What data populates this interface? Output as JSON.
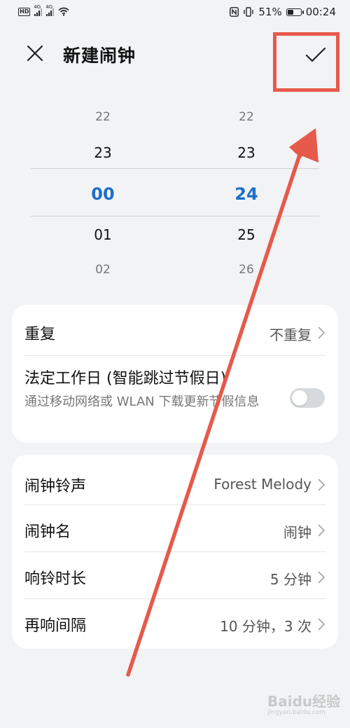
{
  "status_bar": {
    "hd": "HD",
    "net1": "4G",
    "net2": "4G",
    "battery_percent": "51%",
    "battery_level": 0.51,
    "time": "00:24"
  },
  "header": {
    "title": "新建闹钟"
  },
  "picker": {
    "hours": [
      "22",
      "23",
      "00",
      "01",
      "02"
    ],
    "minutes": [
      "22",
      "23",
      "24",
      "25",
      "26"
    ]
  },
  "settings_card_1": {
    "repeat_label": "重复",
    "repeat_value": "不重复",
    "workday_label": "法定工作日 (智能跳过节假日)",
    "workday_sub": "通过移动网络或 WLAN 下载更新节假信息",
    "workday_enabled": false
  },
  "settings_card_2": {
    "rows": [
      {
        "label": "闹钟铃声",
        "value": "Forest Melody"
      },
      {
        "label": "闹钟名",
        "value": "闹钟"
      },
      {
        "label": "响铃时长",
        "value": "5 分钟"
      },
      {
        "label": "再响间隔",
        "value": "10 分钟，3 次"
      }
    ]
  },
  "watermark": {
    "brand": "Baidu经验",
    "url": "jingyan.baidu.com"
  },
  "colors": {
    "accent": "#1e6fc7",
    "annotation": "#e65a4b",
    "background": "#f1f3f5"
  }
}
